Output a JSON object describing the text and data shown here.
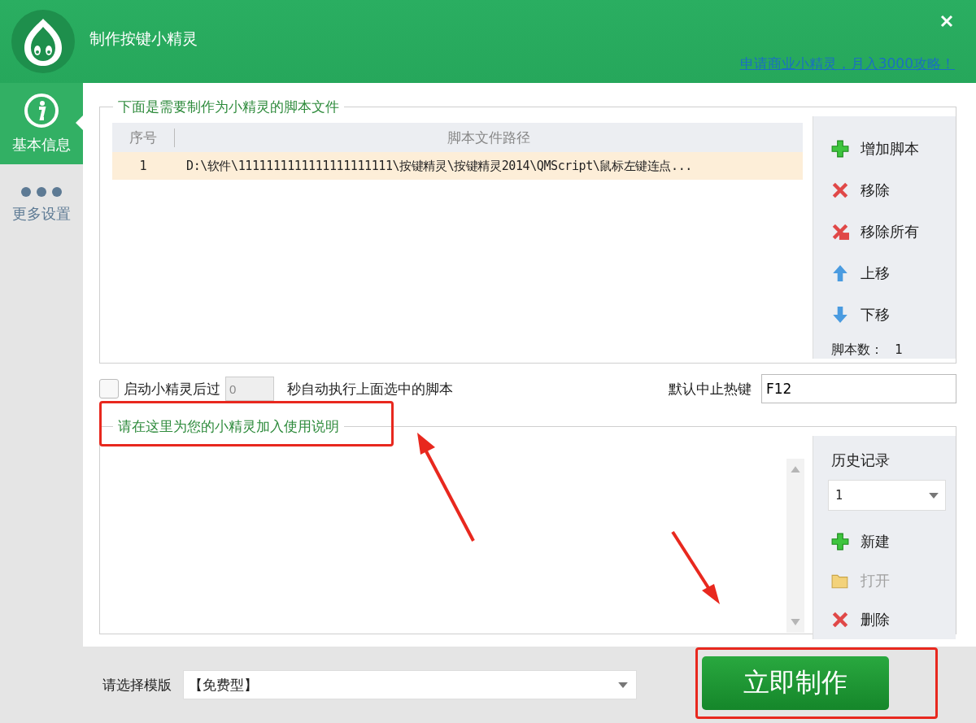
{
  "window": {
    "title": "制作按键小精灵",
    "promo_link": "申请商业小精灵，月入3000攻略！"
  },
  "sidebar": {
    "items": [
      {
        "label": "基本信息",
        "kind": "info",
        "selected": true
      },
      {
        "label": "更多设置",
        "kind": "dots",
        "selected": false
      }
    ]
  },
  "script_group": {
    "title": "下面是需要制作为小精灵的脚本文件",
    "columns": [
      "序号",
      "脚本文件路径"
    ],
    "rows": [
      {
        "index": "1",
        "path": "D:\\软件\\1111111111111111111111\\按键精灵\\按键精灵2014\\QMScript\\鼠标左键连点...",
        "selected": true
      }
    ],
    "actions": [
      {
        "label": "增加脚本",
        "kind": "add",
        "disabled": false
      },
      {
        "label": "移除",
        "kind": "remove",
        "disabled": false
      },
      {
        "label": "移除所有",
        "kind": "remove_all",
        "disabled": false
      },
      {
        "label": "上移",
        "kind": "up",
        "disabled": false
      },
      {
        "label": "下移",
        "kind": "down",
        "disabled": false
      }
    ],
    "count_label": "脚本数：",
    "count": "1"
  },
  "autostart": {
    "checked": false,
    "label_before": "启动小精灵后过",
    "delay": "0",
    "label_after": "秒自动执行上面选中的脚本"
  },
  "hotkey": {
    "label": "默认中止热键",
    "value": "F12"
  },
  "description_group": {
    "title": "请在这里为您的小精灵加入使用说明",
    "history_label": "历史记录",
    "history_value": "1",
    "actions": [
      {
        "label": "新建",
        "kind": "add",
        "disabled": false
      },
      {
        "label": "打开",
        "kind": "open",
        "disabled": true
      },
      {
        "label": "删除",
        "kind": "remove",
        "disabled": false
      }
    ]
  },
  "footer": {
    "template_label": "请选择模版",
    "template_value": "【免费型】",
    "create_button": "立即制作"
  }
}
